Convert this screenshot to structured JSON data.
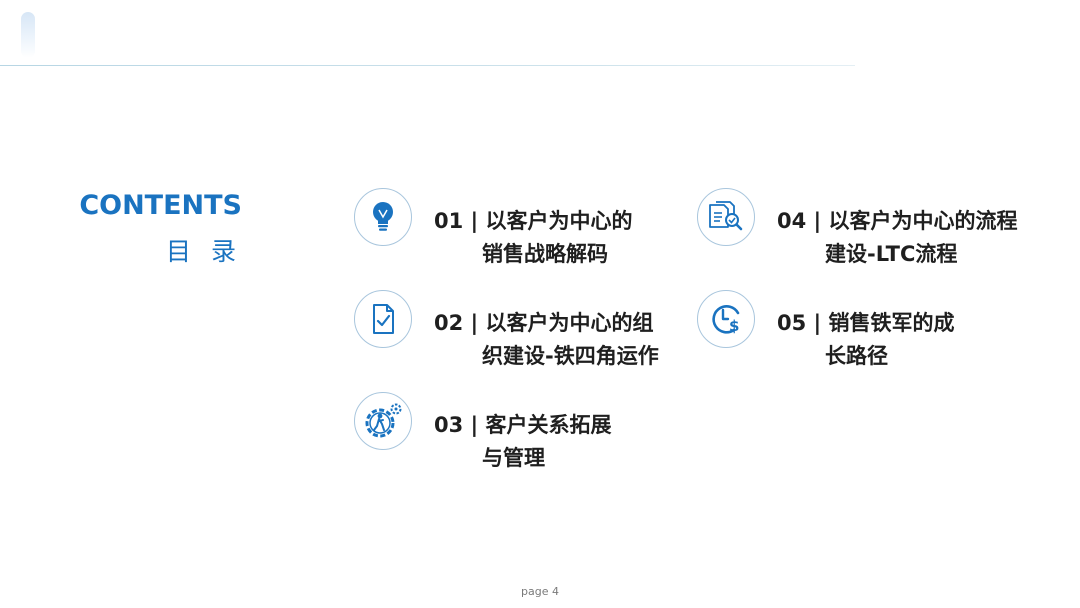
{
  "header": {
    "title": "CONTENTS",
    "subtitle": "目 录"
  },
  "items": [
    {
      "line1": "01 | 以客户为中心的",
      "line2": "销售战略解码",
      "icon": "lightbulb-icon"
    },
    {
      "line1": "02 | 以客户为中心的组",
      "line2": "织建设-铁四角运作",
      "icon": "document-check-icon"
    },
    {
      "line1": "03 | 客户关系拓展",
      "line2": "与管理",
      "icon": "gear-person-icon"
    },
    {
      "line1": "04 | 以客户为中心的流程",
      "line2": "建设-LTC流程",
      "icon": "documents-search-icon"
    },
    {
      "line1": "05 | 销售铁军的成",
      "line2": "长路径",
      "icon": "clock-dollar-icon"
    }
  ],
  "footer": {
    "page": "page 4"
  },
  "colors": {
    "accent": "#1a73c0",
    "icon_border": "#a9c6dd",
    "text": "#1f1f1f"
  }
}
